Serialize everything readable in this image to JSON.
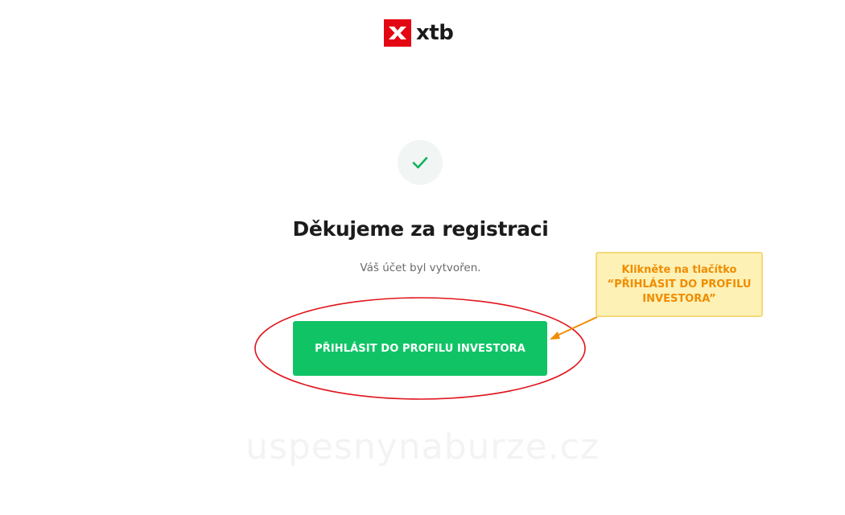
{
  "header": {
    "logo_text": "xtb"
  },
  "main": {
    "title": "Děkujeme za registraci",
    "subtitle": "Váš účet byl vytvořen.",
    "cta_label": "PŘIHLÁSIT DO PROFILU INVESTORA"
  },
  "annotation": {
    "callout_text": "Klikněte na tlačítko\n“PŘIHLÁSIT DO PROFILU\nINVESTORA”"
  },
  "watermark": {
    "text": "uspesnynaburze.cz"
  },
  "colors": {
    "brand_red": "#e30613",
    "cta_green": "#10c466",
    "check_green": "#10b35c",
    "ellipse_red": "#e0151c",
    "callout_orange": "#f08c00"
  },
  "icons": {
    "logo": "xtb-logo-icon",
    "success": "checkmark-icon"
  }
}
